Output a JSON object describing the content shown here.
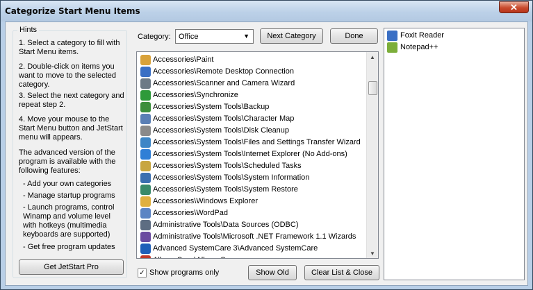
{
  "window": {
    "title": "Categorize Start Menu Items",
    "close_glyph": "✕"
  },
  "hints": {
    "legend": "Hints",
    "steps": [
      "1. Select a category to fill with Start Menu items.",
      "2. Double-click on items you want to move to the selected category.",
      "3. Select the next category and repeat step 2.",
      "4. Move your mouse to the Start Menu button and JetStart menu will appears.",
      "The advanced version of the program is available with the following features:"
    ],
    "features": [
      "- Add your own categories",
      "- Manage startup programs",
      "- Launch programs, control Winamp and volume level with hotkeys (multimedia keyboards are supported)",
      "- Get free program updates"
    ],
    "pro_button": "Get JetStart Pro"
  },
  "category": {
    "label": "Category:",
    "selected": "Office"
  },
  "buttons": {
    "next_category": "Next Category",
    "done": "Done",
    "show_old": "Show Old",
    "clear_close": "Clear List & Close"
  },
  "show_programs_only": {
    "label": "Show programs only",
    "checked": true
  },
  "items": [
    {
      "text": "Accessories\\Paint",
      "icon": "paint-icon",
      "color": "#d9a23a"
    },
    {
      "text": "Accessories\\Remote Desktop Connection",
      "icon": "remote-desktop-icon",
      "color": "#3a6fc4"
    },
    {
      "text": "Accessories\\Scanner and Camera Wizard",
      "icon": "scanner-icon",
      "color": "#6d7a86"
    },
    {
      "text": "Accessories\\Synchronize",
      "icon": "sync-icon",
      "color": "#2e9a3a"
    },
    {
      "text": "Accessories\\System Tools\\Backup",
      "icon": "backup-icon",
      "color": "#3c8f3c"
    },
    {
      "text": "Accessories\\System Tools\\Character Map",
      "icon": "charmap-icon",
      "color": "#5a7fb5"
    },
    {
      "text": "Accessories\\System Tools\\Disk Cleanup",
      "icon": "disk-cleanup-icon",
      "color": "#8a8a8a"
    },
    {
      "text": "Accessories\\System Tools\\Files and Settings Transfer Wizard",
      "icon": "transfer-icon",
      "color": "#3d86c6"
    },
    {
      "text": "Accessories\\System Tools\\Internet Explorer (No Add-ons)",
      "icon": "ie-icon",
      "color": "#2f7fd6"
    },
    {
      "text": "Accessories\\System Tools\\Scheduled Tasks",
      "icon": "scheduled-tasks-icon",
      "color": "#c8a640"
    },
    {
      "text": "Accessories\\System Tools\\System Information",
      "icon": "sysinfo-icon",
      "color": "#3b6fb0"
    },
    {
      "text": "Accessories\\System Tools\\System Restore",
      "icon": "restore-icon",
      "color": "#3a8a6a"
    },
    {
      "text": "Accessories\\Windows Explorer",
      "icon": "explorer-icon",
      "color": "#e0b040"
    },
    {
      "text": "Accessories\\WordPad",
      "icon": "wordpad-icon",
      "color": "#5b84c4"
    },
    {
      "text": "Administrative Tools\\Data Sources (ODBC)",
      "icon": "odbc-icon",
      "color": "#5d6d82"
    },
    {
      "text": "Administrative Tools\\Microsoft .NET Framework 1.1 Wizards",
      "icon": "dotnet-icon",
      "color": "#6a4aa0"
    },
    {
      "text": "Advanced SystemCare 3\\Advanced SystemCare",
      "icon": "systemcare-icon",
      "color": "#1f5fb8"
    },
    {
      "text": "Allway Sync\\Allway Sync",
      "icon": "allway-sync-icon",
      "color": "#c03a2a"
    }
  ],
  "category_items": [
    {
      "text": "Foxit Reader",
      "icon": "foxit-icon",
      "color": "#3a6fc4"
    },
    {
      "text": "Notepad++",
      "icon": "notepad-plus-icon",
      "color": "#7cae3a"
    }
  ]
}
